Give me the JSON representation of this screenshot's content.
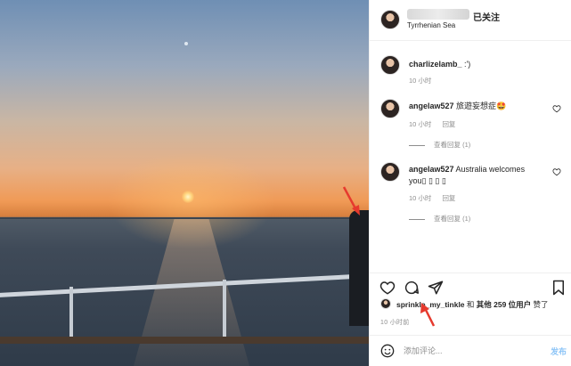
{
  "header": {
    "follow_label": "已关注",
    "location": "Tyrrhenian Sea"
  },
  "caption": {
    "username": "charlizelamb_",
    "text": " :')",
    "time": "10 小时"
  },
  "comments": [
    {
      "username": "angelaw527",
      "text": " 旅遊妄想症🤩",
      "time": "10 小时",
      "reply_label": "回复",
      "view_replies": "查看回复 (1)"
    },
    {
      "username": "angelaw527",
      "text": " Australia welcomes you▯ ▯ ▯ ▯",
      "time": "10 小时",
      "reply_label": "回复",
      "view_replies": "查看回复 (1)"
    }
  ],
  "likes": {
    "user": "sprinkle_my_tinkle",
    "and": " 和 ",
    "others": "其他 259 位用户",
    "suffix": " 赞了"
  },
  "post_time": "10 小时前",
  "comment_input": {
    "placeholder": "添加评论..."
  },
  "post_button": "发布",
  "colors": {
    "post_button": "#8dc5f7",
    "annotation_arrow": "#e63a2e"
  },
  "icons": [
    "heart-icon",
    "comment-icon",
    "share-icon",
    "bookmark-icon",
    "emoji-icon",
    "more-icon"
  ]
}
